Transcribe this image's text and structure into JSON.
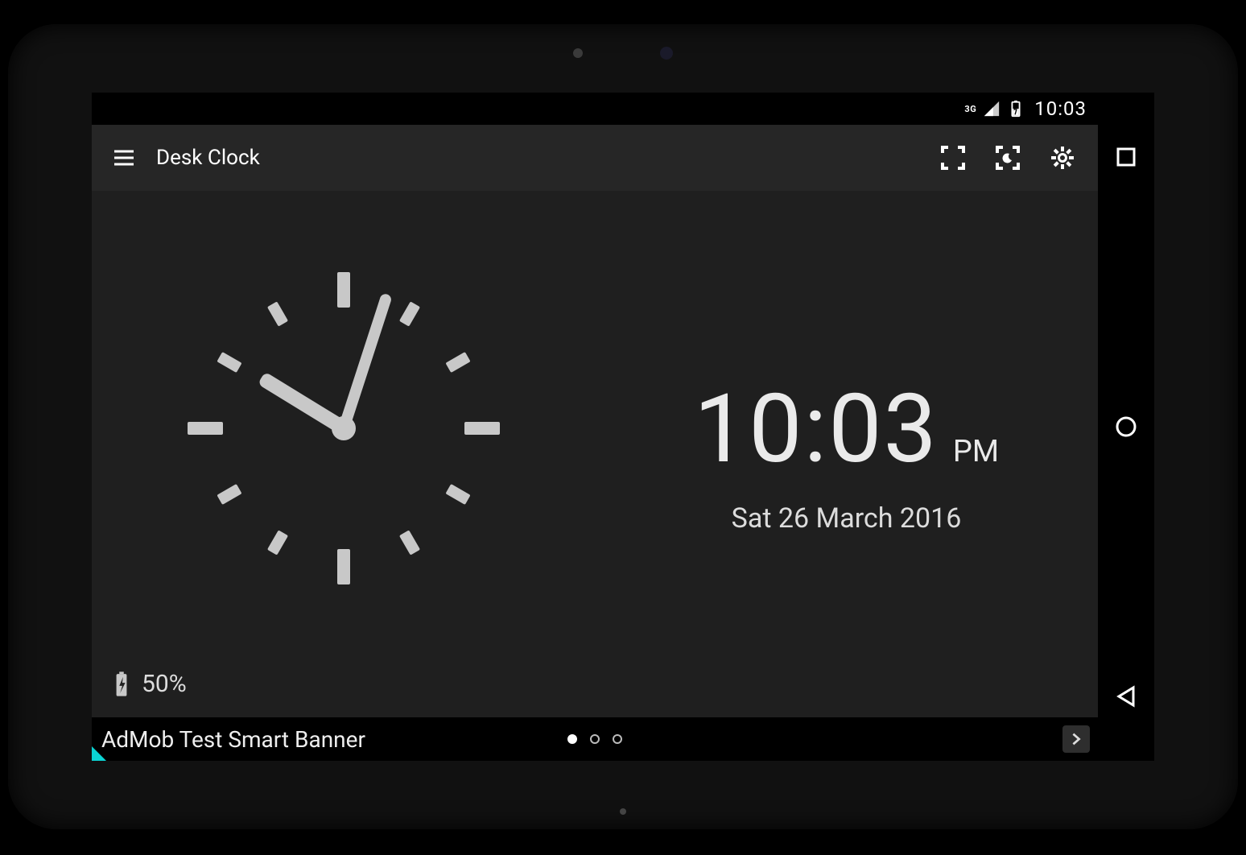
{
  "statusbar": {
    "network_label": "3G",
    "time": "10:03"
  },
  "toolbar": {
    "title": "Desk Clock",
    "icons": {
      "menu": "menu-icon",
      "fullscreen": "fullscreen-icon",
      "night": "night-fullscreen-icon",
      "settings": "gear-icon"
    }
  },
  "clock": {
    "hour": 10,
    "minute": 3,
    "digital_time": "10:03",
    "ampm": "PM",
    "date": "Sat 26 March 2016"
  },
  "battery": {
    "percent_label": "50%"
  },
  "ad": {
    "text": "AdMob Test Smart Banner",
    "pages": 3,
    "active_page": 0
  },
  "navbar": {
    "recent": "recent-apps-icon",
    "home": "home-icon",
    "back": "back-icon"
  }
}
